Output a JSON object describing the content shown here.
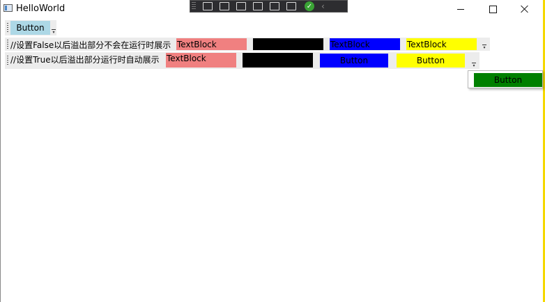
{
  "window": {
    "title": "HelloWorld",
    "buttons": [
      "minimize",
      "maximize",
      "close"
    ]
  },
  "debug_toolbar": {
    "icons": [
      "select-element-icon",
      "video-icon",
      "pointer-icon",
      "layout-adorner-icon",
      "track-focus-icon",
      "hot-reload-icon",
      "check-icon",
      "chevron-left-icon"
    ]
  },
  "toolbar1": {
    "button_label": "Button"
  },
  "toolbar2": {
    "label": "//设置False以后溢出部分不会在运行时展示",
    "items": [
      "TextBlock",
      "",
      "TextBlock",
      "TextBlock"
    ],
    "colors": [
      "#f08080",
      "#000000",
      "#0000ff",
      "#ffff00"
    ]
  },
  "toolbar3": {
    "label": "//设置True以后溢出部分运行时自动展示",
    "items": [
      "TextBlock",
      "",
      "Button",
      "Button"
    ],
    "colors": [
      "#f08080",
      "#000000",
      "#0000ff",
      "#ffff00"
    ]
  },
  "overflow_popup": {
    "button_label": "Button",
    "color": "#008000"
  }
}
